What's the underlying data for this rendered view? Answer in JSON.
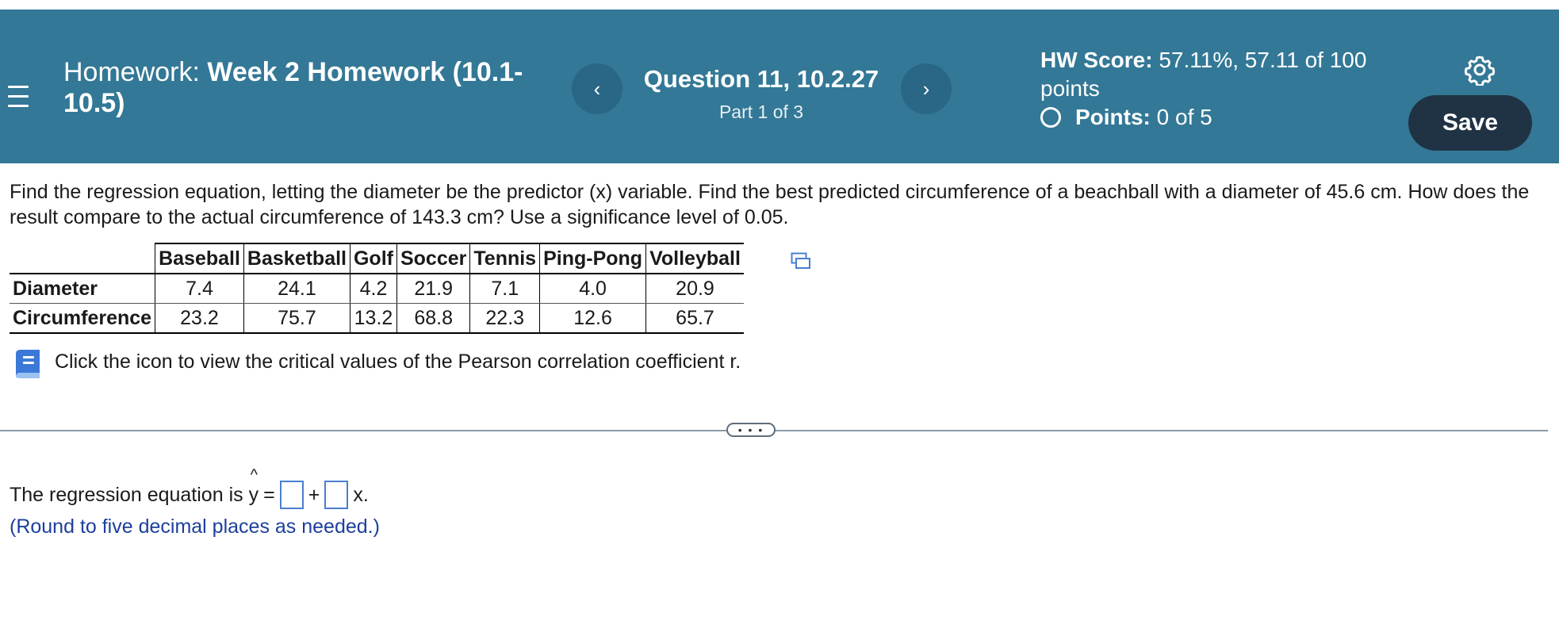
{
  "header": {
    "hw_prefix": "Homework:",
    "hw_name": "Week 2 Homework (10.1-10.5)",
    "question_title": "Question 11, 10.2.27",
    "question_part": "Part 1 of 3",
    "hw_score_label": "HW Score:",
    "hw_score_value": "57.11%, 57.11 of 100 points",
    "points_label": "Points:",
    "points_value": "0 of 5",
    "save_label": "Save",
    "prev_label": "‹",
    "next_label": "›"
  },
  "question": {
    "text": "Find the regression equation, letting the diameter be the predictor (x) variable. Find the best predicted circumference of a beachball with a diameter of 45.6 cm. How does the result compare to the actual circumference of 143.3 cm? Use a significance level of 0.05."
  },
  "table": {
    "columns": [
      "Baseball",
      "Basketball",
      "Golf",
      "Soccer",
      "Tennis",
      "Ping-Pong",
      "Volleyball"
    ],
    "rows": [
      {
        "label": "Diameter",
        "values": [
          "7.4",
          "24.1",
          "4.2",
          "21.9",
          "7.1",
          "4.0",
          "20.9"
        ]
      },
      {
        "label": "Circumference",
        "values": [
          "23.2",
          "75.7",
          "13.2",
          "68.8",
          "22.3",
          "12.6",
          "65.7"
        ]
      }
    ]
  },
  "critical_values_text": "Click the icon to view the critical values of the Pearson correlation coefficient r.",
  "more_label": "• • •",
  "answer": {
    "prefix": "The regression equation is",
    "y": "y",
    "hat": "^",
    "equals": "=",
    "plus": "+",
    "suffix": "x.",
    "note": "(Round to five decimal places as needed.)"
  },
  "colors": {
    "header_bg": "#337896",
    "save_bg": "#1f3345",
    "note_text": "#1c3f9c",
    "input_border": "#4a7fd0"
  }
}
